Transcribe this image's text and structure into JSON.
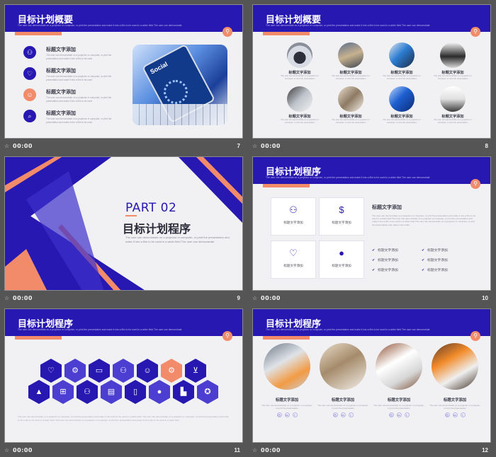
{
  "colors": {
    "primary": "#2618b0",
    "accent": "#f28b6a",
    "slide_bg": "#f1f1f3",
    "app_bg": "#555555"
  },
  "footer_time": "00:00",
  "slides": [
    {
      "number": "7",
      "title": "目标计划概要",
      "subtitle": "The user can demonstrate on a projector or computer, or print the presentation and make it into a film to be used in a wider field The user can demonstrate",
      "items": [
        {
          "title": "标题文字添加",
          "body": "The user can demonstrate on a projector or computer, or print the presentation and make it into a film to be used",
          "icon": "people-icon"
        },
        {
          "title": "标题文字添加",
          "body": "The user can demonstrate on a projector or computer, or print the presentation and make it into a film to be used",
          "icon": "heart-icon"
        },
        {
          "title": "标题文字添加",
          "body": "The user can demonstrate on a projector or computer, or print the presentation and make it into a film to be used",
          "icon": "user-icon"
        },
        {
          "title": "标题文字添加",
          "body": "The user can demonstrate on a projector or computer, or print the presentation and make it into a film to be used",
          "icon": "search-icon"
        }
      ],
      "photo_text": "Social"
    },
    {
      "number": "8",
      "title": "目标计划概要",
      "subtitle": "The user can demonstrate on a projector or computer, or print the presentation and make it into a film to be used in a wider field The user can demonstrate",
      "items": [
        {
          "title": "标题文字添加",
          "body": "The user can demonstrate on a projector or computer, or print the presentation"
        },
        {
          "title": "标题文字添加",
          "body": "The user can demonstrate on a projector or computer, or print the presentation"
        },
        {
          "title": "标题文字添加",
          "body": "The user can demonstrate on a projector or computer, or print the presentation"
        },
        {
          "title": "标题文字添加",
          "body": "The user can demonstrate on a projector or computer, or print the presentation"
        },
        {
          "title": "标题文字添加",
          "body": "The user can demonstrate on a projector or computer, or print the presentation"
        },
        {
          "title": "标题文字添加",
          "body": "The user can demonstrate on a projector or computer, or print the presentation"
        },
        {
          "title": "标题文字添加",
          "body": "The user can demonstrate on a projector or computer, or print the presentation"
        },
        {
          "title": "标题文字添加",
          "body": "The user can demonstrate on a projector or computer, or print the presentation"
        }
      ]
    },
    {
      "number": "9",
      "part": "PART 02",
      "title": "目标计划程序",
      "body": "The user can demonstrate on a projector or computer, or print the presentation and make it into a film to be used in a wider field The user can demonstrate"
    },
    {
      "number": "10",
      "title": "目标计划程序",
      "subtitle": "The user can demonstrate on a projector or computer, or print the presentation and make it into a film to be used in a wider field The user can demonstrate",
      "boxes": [
        {
          "label": "标题文字添加",
          "icon": "people-icon"
        },
        {
          "label": "标题文字添加",
          "icon": "dollar-icon"
        },
        {
          "label": "标题文字添加",
          "icon": "heart-icon"
        },
        {
          "label": "标题文字添加",
          "icon": "globe-icon"
        }
      ],
      "right_title": "标题文字添加",
      "right_body": "The user can demonstrate on a projector or computer, or print the presentation and make it into a film to be used in a wider field The user can demonstrate on a projector or computer, or print the presentation and make it into a film to be used in a wider field The user can demonstrate on a projector or computer, or print the presentation and make it into a film",
      "checks": [
        "标题文字添加",
        "标题文字添加",
        "标题文字添加",
        "标题文字添加",
        "标题文字添加",
        "标题文字添加"
      ]
    },
    {
      "number": "11",
      "title": "目标计划程序",
      "subtitle": "The user can demonstrate on a projector or computer, or print the presentation and make it into a film to be used in a wider field The user can demonstrate",
      "footer_text": "The user can demonstrate on a projector or computer, or print the presentation and make it into a film to be used in a wider field. The user can demonstrate on a projector or computer, or print the presentation and make it into a film to be used in a wider field. The user can demonstrate on a projector or computer, or print the presentation and make it into a film to be used in a wider field"
    },
    {
      "number": "12",
      "title": "目标计划程序",
      "subtitle": "The user can demonstrate on a projector or computer, or print the presentation and make it into a film to be used in a wider field The user can demonstrate",
      "items": [
        {
          "title": "标题文字添加",
          "body": "The user can demonstrate on a projector or computer, or print the presentation"
        },
        {
          "title": "标题文字添加",
          "body": "The user can demonstrate on a projector or computer, or print the presentation"
        },
        {
          "title": "标题文字添加",
          "body": "The user can demonstrate on a projector or computer, or print the presentation"
        },
        {
          "title": "标题文字添加",
          "body": "The user can demonstrate on a projector or computer, or print the presentation"
        }
      ]
    }
  ]
}
